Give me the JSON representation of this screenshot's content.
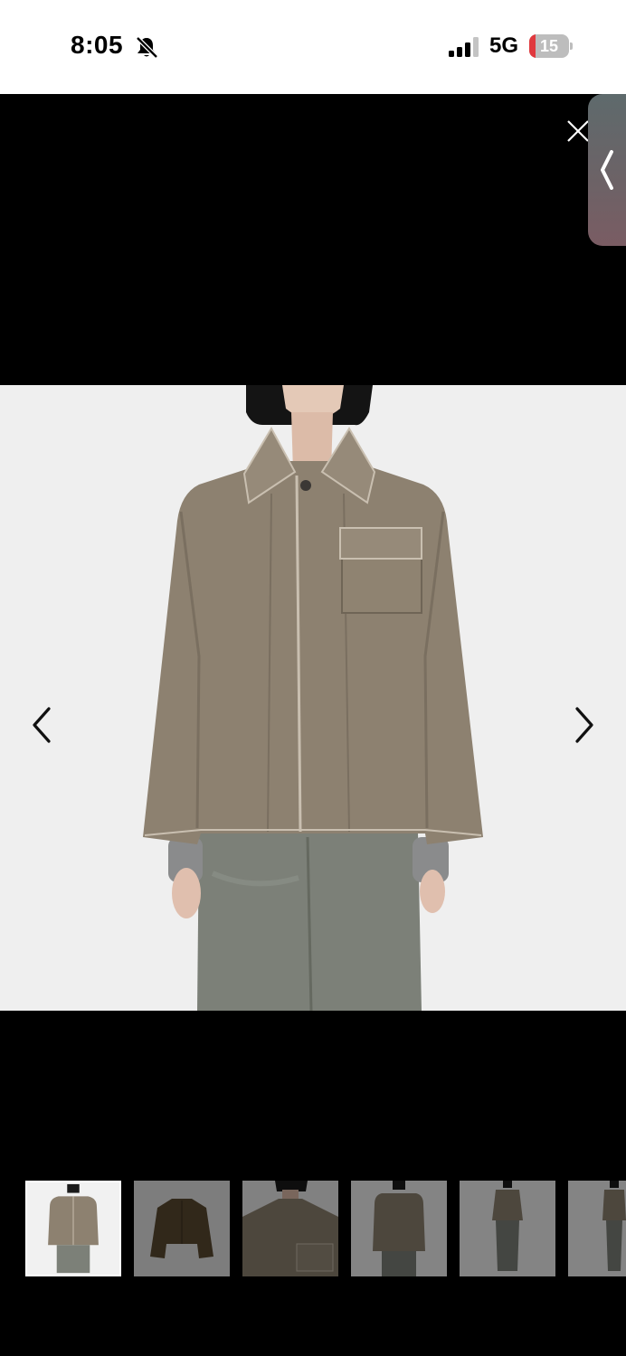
{
  "status_bar": {
    "time": "8:05",
    "network": "5G",
    "battery_level": "15",
    "battery_fraction": 0.15,
    "icons": [
      "bell-slash-icon",
      "cellular-signal-icon",
      "battery-icon"
    ]
  },
  "viewer": {
    "icons": [
      "close-icon",
      "chevron-left-icon",
      "chevron-right-icon",
      "side-panel-chevron-icon"
    ],
    "thumbnail_count_visible": 6,
    "active_thumbnail_index": 0
  },
  "colors": {
    "background": "#000000",
    "photo_background": "#efefef",
    "jacket": "#8d8170",
    "jeans": "#7c8078",
    "battery_low": "#e0393e"
  }
}
